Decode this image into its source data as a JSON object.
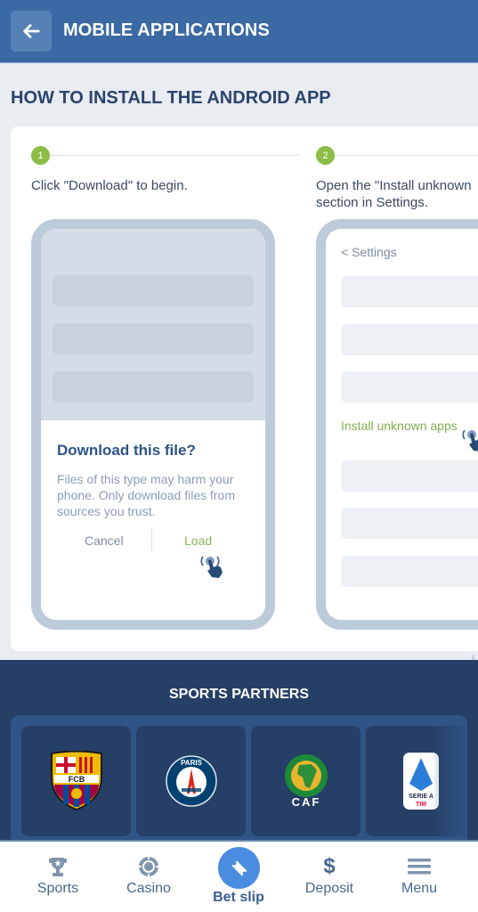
{
  "header": {
    "title": "MOBILE APPLICATIONS",
    "back_icon": "arrow-left-icon"
  },
  "section": {
    "title": "HOW TO INSTALL THE ANDROID APP"
  },
  "steps": [
    {
      "number": "1",
      "text": "Click \"Download\" to begin.",
      "dialog": {
        "title": "Download this file?",
        "body": "Files of this type may harm your phone. Only download files from sources you trust.",
        "cancel_label": "Cancel",
        "load_label": "Load"
      }
    },
    {
      "number": "2",
      "text_line1": "Open the \"Install unknown",
      "text_line2": "section in Settings.",
      "settings_back": "< Settings",
      "highlight_item": "Install unknown apps"
    }
  ],
  "partners": {
    "title": "SPORTS PARTNERS",
    "items": [
      {
        "name": "FC Barcelona",
        "logo_text": "FCB"
      },
      {
        "name": "Paris Saint-Germain",
        "logo_text": "PARIS"
      },
      {
        "name": "CAF",
        "logo_text": "CAF"
      },
      {
        "name": "Serie A TIM",
        "logo_text": "SERIE A",
        "logo_sub": "TIM"
      }
    ]
  },
  "bottom_nav": {
    "items": [
      {
        "label": "Sports",
        "icon": "trophy-icon"
      },
      {
        "label": "Casino",
        "icon": "chip-icon"
      },
      {
        "label": "Bet slip",
        "icon": "ticket-icon",
        "active": true
      },
      {
        "label": "Deposit",
        "icon": "dollar-icon"
      },
      {
        "label": "Menu",
        "icon": "hamburger-icon"
      }
    ]
  },
  "colors": {
    "header_bg": "#3a69a3",
    "accent_green": "#8cbd45",
    "partners_bg": "#263f66",
    "betslip_blue": "#4a8de0"
  }
}
